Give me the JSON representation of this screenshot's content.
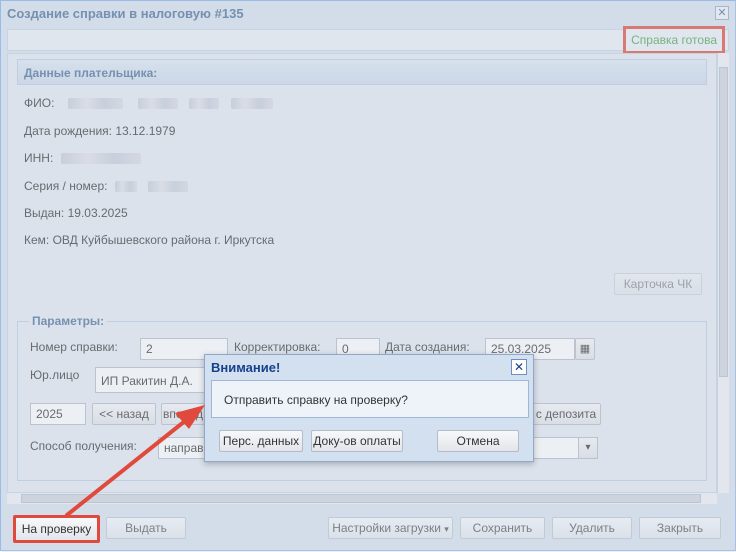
{
  "window": {
    "title": "Создание справки в налоговую #135",
    "status": "Справка готова"
  },
  "payer": {
    "header": "Данные плательщика:",
    "fio_label": "ФИО:",
    "dob_label": "Дата рождения:",
    "dob_value": "13.12.1979",
    "inn_label": "ИНН:",
    "series_label": "Серия / номер:",
    "issued_label": "Выдан:",
    "issued_value": "19.03.2025",
    "by_label": "Кем:",
    "by_value": "ОВД Куйбышевского района г. Иркутска",
    "card_button": "Карточка ЧК"
  },
  "params": {
    "legend": "Параметры:",
    "number_label": "Номер справки:",
    "number_value": "2",
    "correction_label": "Корректировка:",
    "correction_value": "0",
    "created_label": "Дата создания:",
    "created_value": "25.03.2025",
    "org_label": "Юр.лицо",
    "org_value": "ИП Ракитин Д.А.",
    "year_value": "2025",
    "back_button": "<< назад",
    "forward_button": "вперёд",
    "deposit_button": "с депозита",
    "method_label": "Способ получения:",
    "method_value": "направ"
  },
  "dialog": {
    "title": "Внимание!",
    "message": "Отправить справку на проверку?",
    "btn_personal": "Перс. данных",
    "btn_payment": "Доку-ов оплаты",
    "btn_cancel": "Отмена"
  },
  "footer": {
    "check": "На проверку",
    "issue": "Выдать",
    "upload_settings": "Настройки загрузки",
    "save": "Сохранить",
    "delete": "Удалить",
    "close": "Закрыть"
  },
  "colors": {
    "highlight": "#e04a3c",
    "status_green": "#4ca24c",
    "title_blue": "#4b6e99"
  }
}
